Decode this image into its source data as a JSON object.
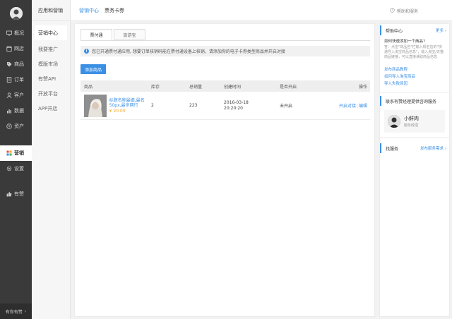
{
  "sidebar": {
    "items": [
      {
        "label": "概况",
        "icon": "monitor-icon"
      },
      {
        "label": "网店",
        "icon": "store-icon"
      },
      {
        "label": "商品",
        "icon": "tag-icon"
      },
      {
        "label": "订单",
        "icon": "order-icon"
      },
      {
        "label": "客户",
        "icon": "user-icon"
      },
      {
        "label": "数据",
        "icon": "chart-icon"
      },
      {
        "label": "资产",
        "icon": "money-icon"
      },
      {
        "label": "营销",
        "icon": "grid-icon"
      },
      {
        "label": "设置",
        "icon": "gear-icon"
      },
      {
        "label": "有赞",
        "icon": "thumb-up-icon"
      }
    ],
    "bottom_label": "有你有赞"
  },
  "subnav": {
    "title": "应用和营销",
    "items": [
      "营销中心",
      "我要推广",
      "模版市场",
      "有赞API",
      "开放平台",
      "APP开店"
    ]
  },
  "header": {
    "crumb1": "营销中心",
    "crumb2": "票务卡券",
    "help": "帮助和服务"
  },
  "main": {
    "tabs": [
      "票付通",
      "旅游宝"
    ],
    "notice": "您已开通票付通应用, 想要订单核销码能在票付通设备上核销，请添加你的电子卡券类型商品并开启对接",
    "add_button": "添加商品",
    "table": {
      "headers": [
        "商品",
        "库存",
        "总销量",
        "创建时间",
        "是否开启",
        "操作"
      ],
      "rows": [
        {
          "name": "标题名称最细,最名50px,最多两行",
          "price": "¥ 20.00",
          "stock": "2",
          "sales": "223",
          "date": "2016-03-18",
          "time": "20:20:20",
          "status": "未开启",
          "op1": "开启对接",
          "op2": "编辑"
        }
      ]
    }
  },
  "right": {
    "help_title": "帮助中心",
    "more": "更多",
    "question": "如何快速添加一个商品?",
    "answer": "答：点击\"商品名\"栏输入规名店的\"快速导入淘宝商品信息\"，输入淘宝/天猫商品链接，可以直接读取商品信息",
    "links": [
      "发布商品教程",
      "如何导入淘宝商品",
      "导入失败原因"
    ],
    "contact_title": "联系有赞经理提供咨询服务",
    "agent_name": "小鲜肉",
    "agent_role": "服务经理",
    "find_title": "找服务",
    "find_link": "发布服务需求"
  }
}
